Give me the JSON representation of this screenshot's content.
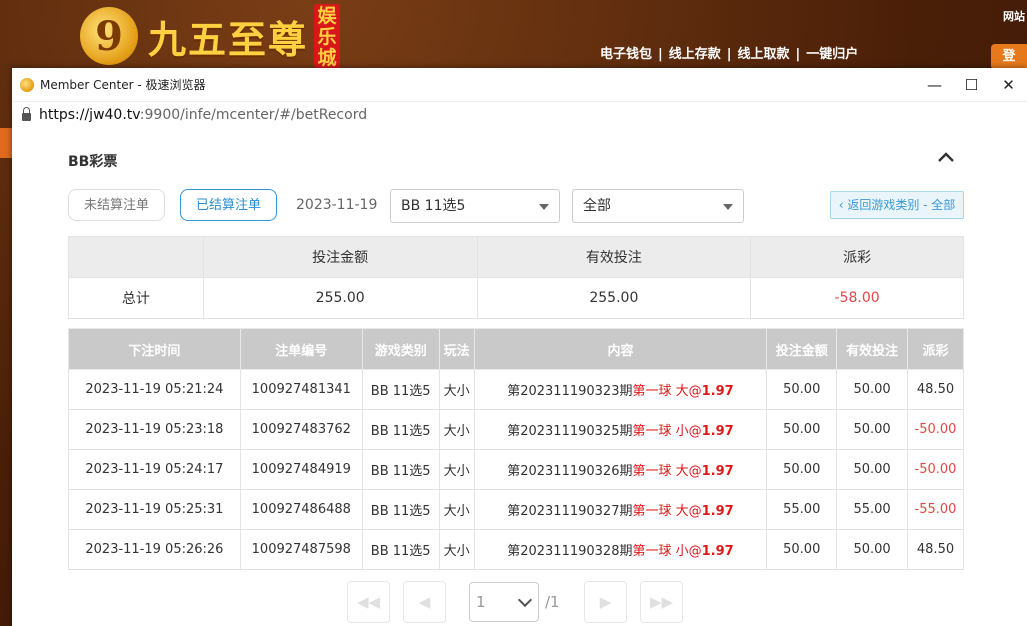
{
  "background_site": {
    "logo_digit": "9",
    "brand": "九五至尊",
    "brand_tag": "娱乐城",
    "nav": [
      "电子钱包",
      "线上存款",
      "线上取款",
      "一键归户"
    ],
    "nav_sep": "|",
    "top_right": "网站",
    "orange_btn": "登"
  },
  "window": {
    "title": "Member Center - 极速浏览器",
    "url_host": "https://jw40.tv",
    "url_rest": ":9900/infe/mcenter/#/betRecord"
  },
  "section": {
    "title": "BB彩票"
  },
  "filters": {
    "unsettled_label": "未结算注单",
    "settled_label": "已结算注单",
    "date": "2023-11-19",
    "game_select": "BB 11选5",
    "type_select": "全部",
    "back_label": "‹ 返回游戏类别 - 全部"
  },
  "summary": {
    "headers": [
      "",
      "投注金额",
      "有效投注",
      "派彩"
    ],
    "row": [
      "总计",
      "255.00",
      "255.00",
      "-58.00"
    ]
  },
  "records": {
    "headers": [
      "下注时间",
      "注单编号",
      "游戏类别",
      "玩法",
      "内容",
      "投注金额",
      "有效投注",
      "派彩"
    ],
    "rows": [
      {
        "time": "2023-11-19 05:21:24",
        "id": "100927481341",
        "game": "BB 11选5",
        "play": "大小",
        "period": "第202311190323期",
        "pick": "第一球 大@",
        "odds": "1.97",
        "amount": "50.00",
        "valid": "50.00",
        "payout": "48.50"
      },
      {
        "time": "2023-11-19 05:23:18",
        "id": "100927483762",
        "game": "BB 11选5",
        "play": "大小",
        "period": "第202311190325期",
        "pick": "第一球 小@",
        "odds": "1.97",
        "amount": "50.00",
        "valid": "50.00",
        "payout": "-50.00"
      },
      {
        "time": "2023-11-19 05:24:17",
        "id": "100927484919",
        "game": "BB 11选5",
        "play": "大小",
        "period": "第202311190326期",
        "pick": "第一球 大@",
        "odds": "1.97",
        "amount": "50.00",
        "valid": "50.00",
        "payout": "-50.00"
      },
      {
        "time": "2023-11-19 05:25:31",
        "id": "100927486488",
        "game": "BB 11选5",
        "play": "大小",
        "period": "第202311190327期",
        "pick": "第一球 大@",
        "odds": "1.97",
        "amount": "55.00",
        "valid": "55.00",
        "payout": "-55.00"
      },
      {
        "time": "2023-11-19 05:26:26",
        "id": "100927487598",
        "game": "BB 11选5",
        "play": "大小",
        "period": "第202311190328期",
        "pick": "第一球 小@",
        "odds": "1.97",
        "amount": "50.00",
        "valid": "50.00",
        "payout": "48.50"
      }
    ]
  },
  "pager": {
    "first": "◀◀",
    "prev": "◀",
    "next": "▶",
    "last": "▶▶",
    "current": "1",
    "total": "/1"
  }
}
